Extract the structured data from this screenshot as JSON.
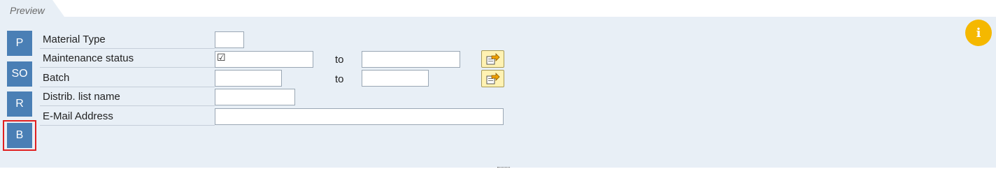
{
  "tab": {
    "label": "Preview"
  },
  "sidebar": {
    "buttons": [
      {
        "label": "P"
      },
      {
        "label": "SO"
      },
      {
        "label": "R"
      },
      {
        "label": "B"
      }
    ]
  },
  "form": {
    "material_type": {
      "label": "Material Type",
      "value": ""
    },
    "maintenance_status": {
      "label": "Maintenance status",
      "value": "☑",
      "to_label": "to",
      "to_value": ""
    },
    "batch": {
      "label": "Batch",
      "value": "",
      "to_label": "to",
      "to_value": ""
    },
    "distrib_list": {
      "label": "Distrib. list name",
      "value": ""
    },
    "email": {
      "label": "E-Mail Address",
      "value": ""
    }
  },
  "colors": {
    "accent": "#4a7fb5",
    "panel": "#e8eff6",
    "info": "#f5b800",
    "highlight": "#e02020"
  },
  "icons": {
    "info": "i",
    "multiple_selection": "multiple-selection-icon"
  }
}
